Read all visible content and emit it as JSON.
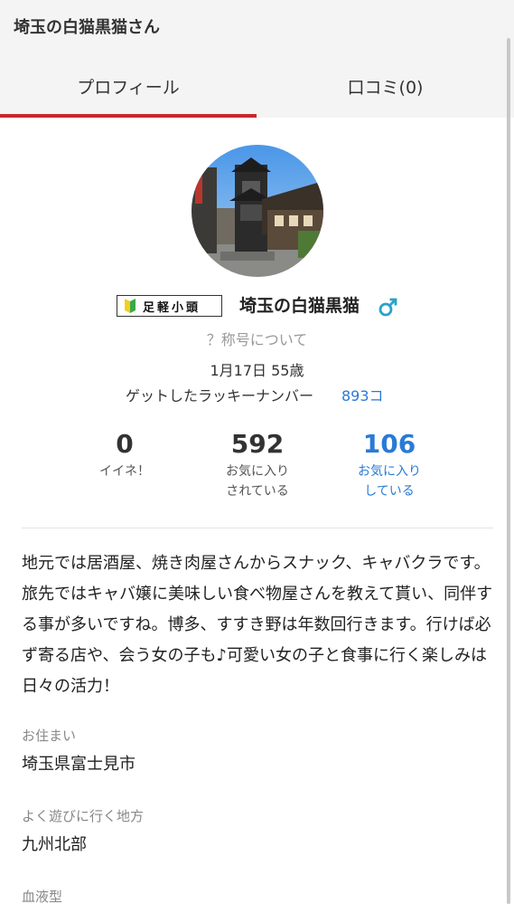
{
  "header": {
    "title": "埼玉の白猫黒猫さん"
  },
  "tabs": [
    {
      "label": "プロフィール",
      "active": true
    },
    {
      "label": "口コミ(0)",
      "active": false
    }
  ],
  "colors": {
    "accent": "#c9282d",
    "link": "#2a7ad5",
    "gender": "#29a3c9"
  },
  "profile": {
    "badge": "足軽小頭",
    "username": "埼玉の白猫黒猫",
    "gender_icon": "male-icon",
    "title_help": "？称号について",
    "birthday_age": "1月17日 55歳",
    "lucky_label": "ゲットしたラッキーナンバー",
    "lucky_value": "893コ"
  },
  "stats": [
    {
      "value": "0",
      "label_lines": [
        "イイネ！"
      ]
    },
    {
      "value": "592",
      "label_lines": [
        "お気に入り",
        "されている"
      ]
    },
    {
      "value": "106",
      "label_lines": [
        "お気に入り",
        "している"
      ]
    }
  ],
  "bio": "地元では居酒屋、焼き肉屋さんからスナック、キャバクラです。旅先ではキャバ嬢に美味しい食べ物屋さんを教えて貰い、同伴する事が多いですね。博多、すすき野は年数回行きます。行けば必ず寄る店や、会う女の子も♪可愛い女の子と食事に行く楽しみは日々の活力！",
  "fields": [
    {
      "label": "お住まい",
      "value": "埼玉県富士見市"
    },
    {
      "label": "よく遊びに行く地方",
      "value": "九州北部"
    },
    {
      "label": "血液型",
      "value": ""
    }
  ]
}
